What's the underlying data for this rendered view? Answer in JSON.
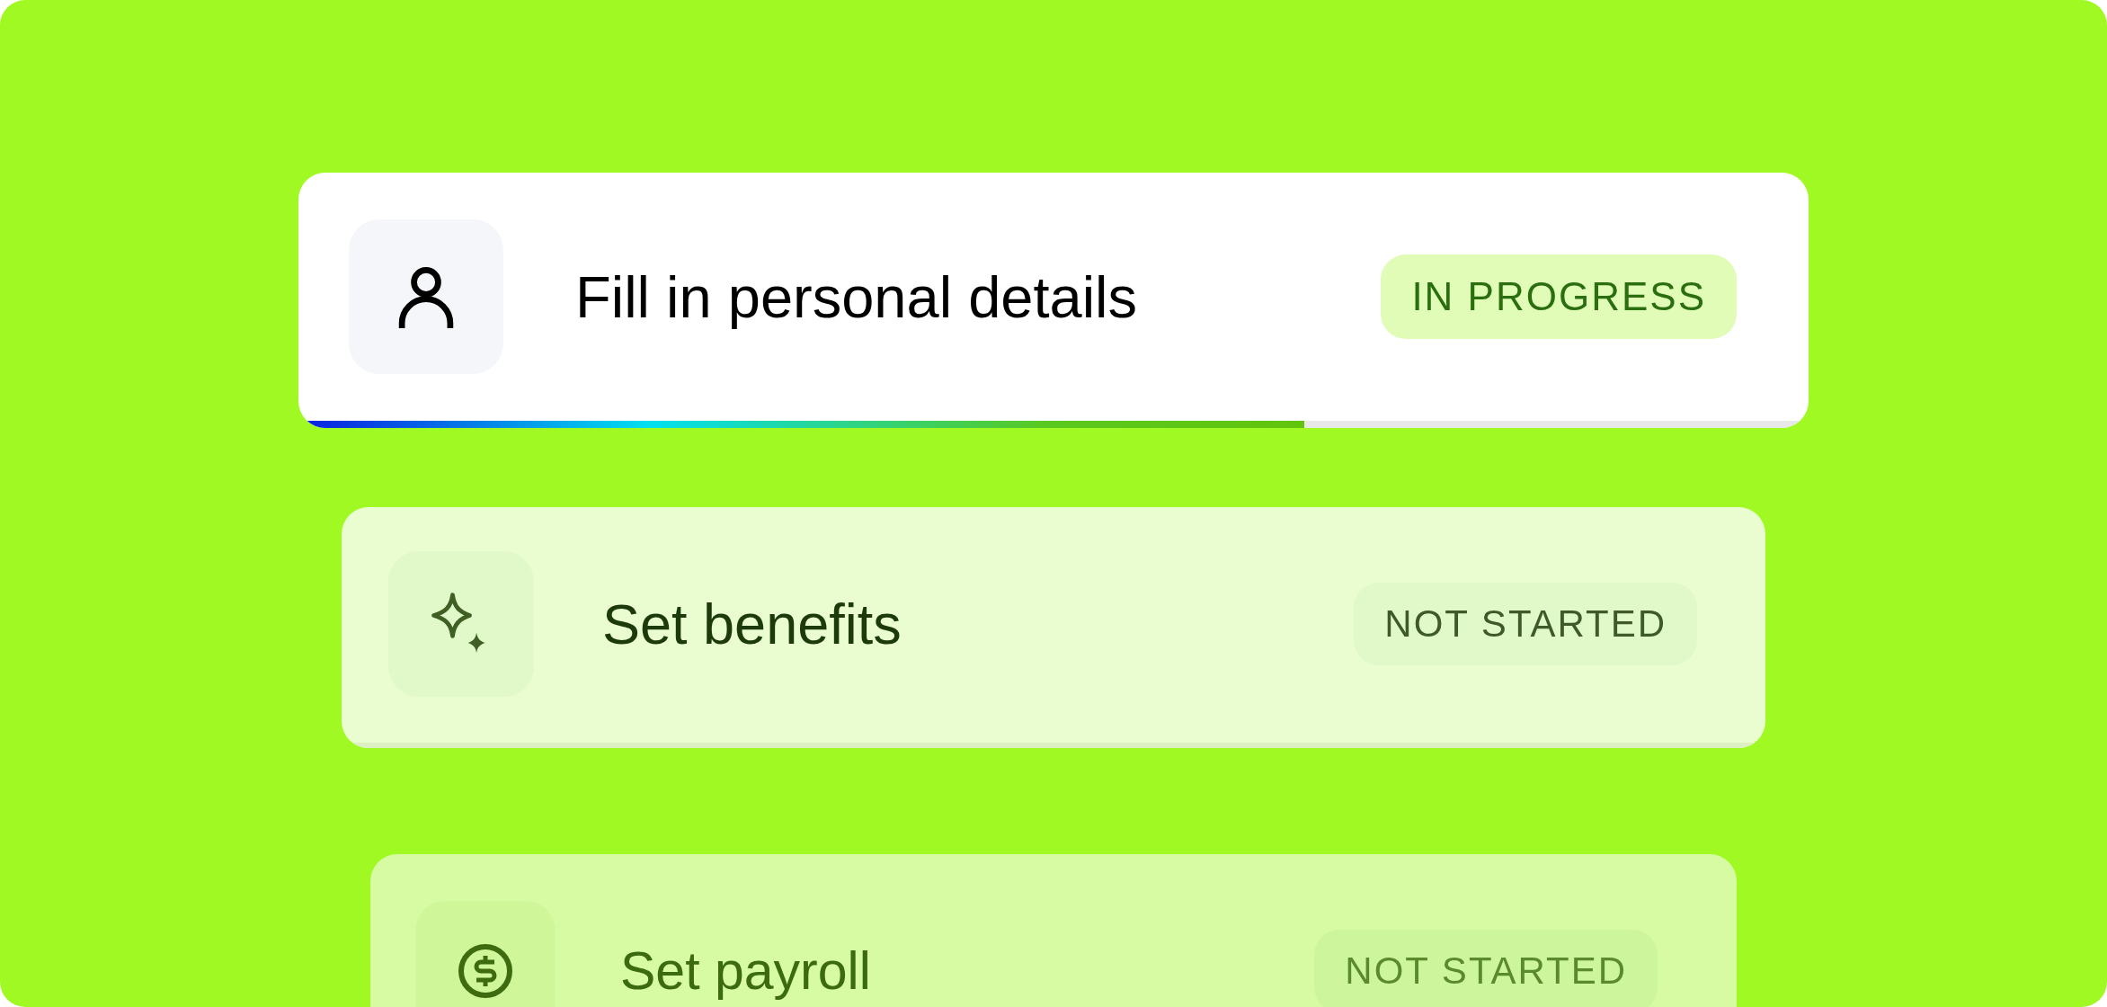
{
  "tasks": [
    {
      "kind": "person",
      "title": "Fill in personal details",
      "status": {
        "label": "IN PROGRESS",
        "kind": "in_progress"
      },
      "level": 0.666
    },
    {
      "kind": "sparkle",
      "title": "Set benefits",
      "status": {
        "label": "NOT STARTED",
        "kind": "not_started"
      }
    },
    {
      "kind": "dollar",
      "title": "Set payroll",
      "status": {
        "label": "NOT STARTED",
        "kind": "not_started"
      }
    }
  ]
}
